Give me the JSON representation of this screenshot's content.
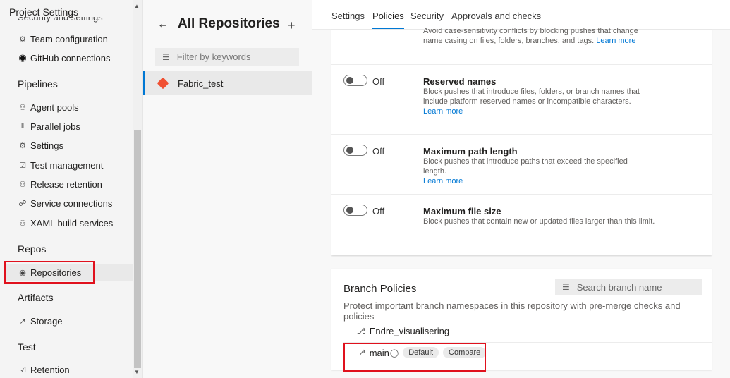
{
  "nav": {
    "title": "Project Settings",
    "cut_item": "Security and settings",
    "general_items": [
      {
        "label": "Team configuration",
        "icon": "team-config-icon"
      },
      {
        "label": "GitHub connections",
        "icon": "github-icon"
      }
    ],
    "sections": [
      {
        "name": "Pipelines",
        "items": [
          {
            "label": "Agent pools",
            "icon": "agent-pools-icon"
          },
          {
            "label": "Parallel jobs",
            "icon": "parallel-jobs-icon"
          },
          {
            "label": "Settings",
            "icon": "gear-icon"
          },
          {
            "label": "Test management",
            "icon": "test-management-icon"
          },
          {
            "label": "Release retention",
            "icon": "release-retention-icon"
          },
          {
            "label": "Service connections",
            "icon": "service-connections-icon"
          },
          {
            "label": "XAML build services",
            "icon": "xaml-build-icon"
          }
        ]
      },
      {
        "name": "Repos",
        "items": [
          {
            "label": "Repositories",
            "icon": "repositories-icon",
            "selected": true
          }
        ]
      },
      {
        "name": "Artifacts",
        "items": [
          {
            "label": "Storage",
            "icon": "storage-icon"
          }
        ]
      },
      {
        "name": "Test",
        "items": [
          {
            "label": "Retention",
            "icon": "retention-icon"
          }
        ]
      }
    ]
  },
  "repos": {
    "heading": "All Repositories",
    "filter_placeholder": "Filter by keywords",
    "items": [
      {
        "label": "Fabric_test"
      }
    ]
  },
  "tabs": [
    "Settings",
    "Policies",
    "Security",
    "Approvals and checks"
  ],
  "active_tab": "Policies",
  "policies": {
    "top_partial": {
      "desc": "Avoid case-sensitivity conflicts by blocking pushes that change name casing on files, folders, branches, and tags.",
      "link": "Learn more"
    },
    "items": [
      {
        "toggle": "Off",
        "title": "Reserved names",
        "desc": "Block pushes that introduce files, folders, or branch names that include platform reserved names or incompatible characters.",
        "link": "Learn more"
      },
      {
        "toggle": "Off",
        "title": "Maximum path length",
        "desc": "Block pushes that introduce paths that exceed the specified length.",
        "link": "Learn more"
      },
      {
        "toggle": "Off",
        "title": "Maximum file size",
        "desc": "Block pushes that contain new or updated files larger than this limit.",
        "link": ""
      }
    ]
  },
  "branch_policies": {
    "heading": "Branch Policies",
    "search_placeholder": "Search branch name",
    "desc": "Protect important branch namespaces in this repository with pre-merge checks and policies",
    "branches": [
      {
        "name": "Endre_visualisering"
      },
      {
        "name": "main",
        "badges": [
          "Default",
          "Compare"
        ]
      }
    ]
  },
  "colors": {
    "accent": "#0078d4",
    "highlight_box": "#e0111d",
    "git": "#f05133"
  }
}
